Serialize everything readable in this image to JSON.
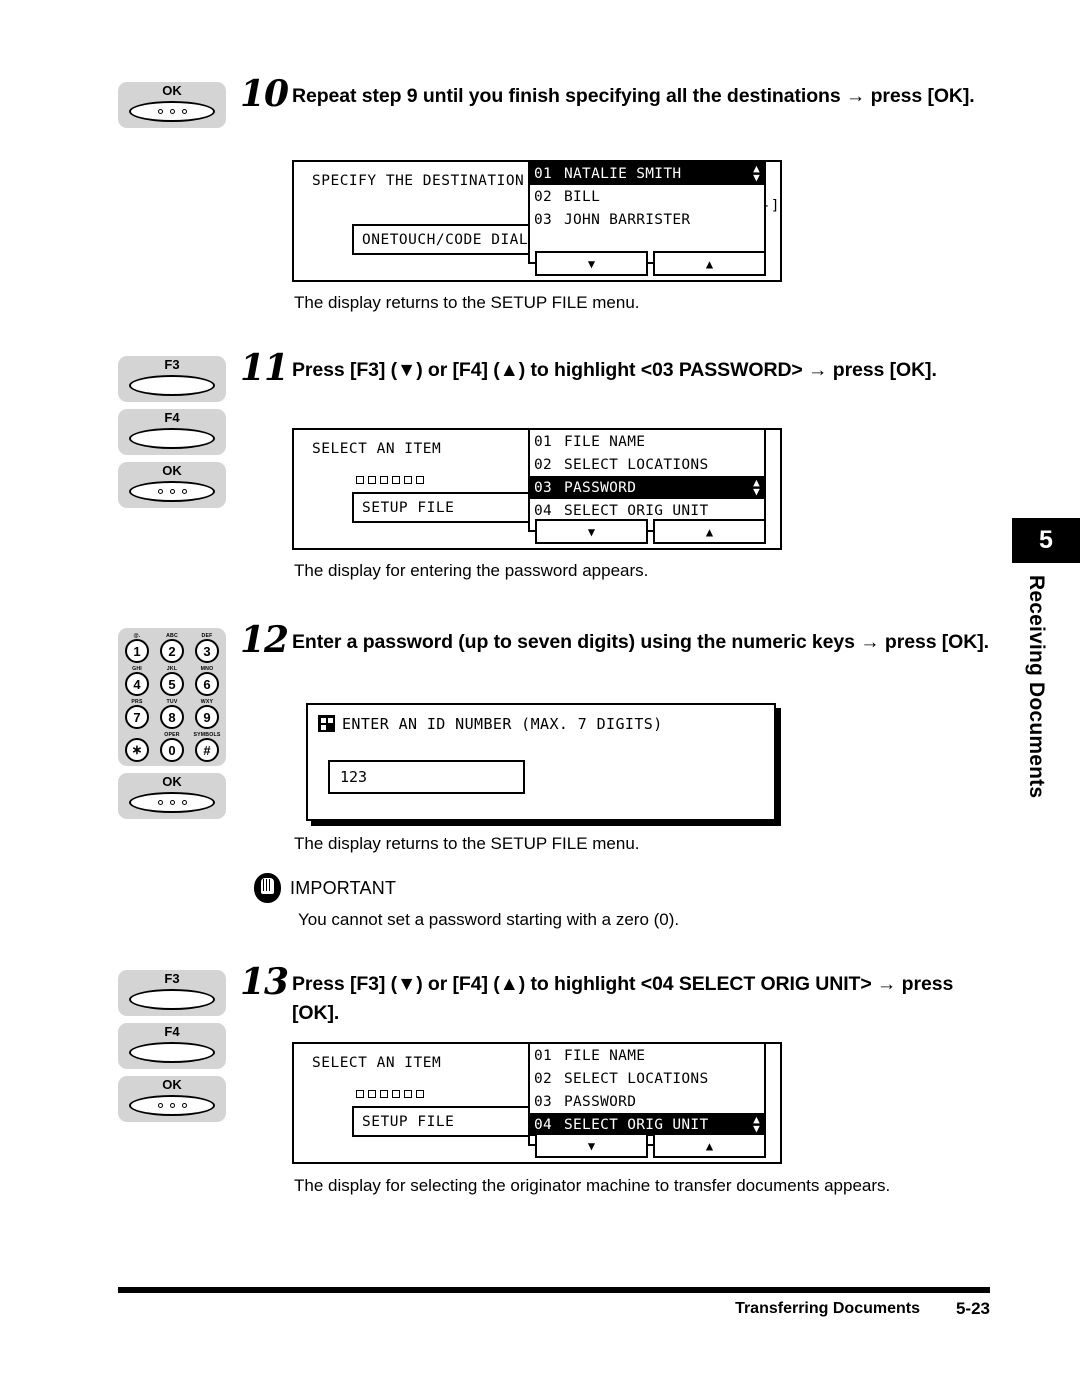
{
  "chapter_tab": {
    "number": "5",
    "title": "Receiving Documents"
  },
  "steps": [
    {
      "number": "10",
      "instruction": "Repeat step 9 until you finish specifying all the destinations → press [OK].",
      "keys": [
        {
          "label": "OK",
          "type": "lens-dots"
        }
      ],
      "caption": "The display returns to the SETUP FILE menu.",
      "lcd": {
        "type": "list",
        "title": "SPECIFY THE DESTINATION",
        "number_field": "No. [----]",
        "left_box": "ONETOUCH/CODE DIAL",
        "show_squares": false,
        "rows": [
          {
            "index": "01",
            "label": "NATALIE SMITH",
            "selected": true
          },
          {
            "index": "02",
            "label": "BILL",
            "selected": false
          },
          {
            "index": "03",
            "label": "JOHN BARRISTER",
            "selected": false
          }
        ],
        "softkeys": [
          "▼",
          "▲"
        ]
      }
    },
    {
      "number": "11",
      "instruction": "Press [F3] (▼) or [F4] (▲) to highlight <03 PASSWORD> → press [OK].",
      "keys": [
        {
          "label": "F3",
          "type": "lens"
        },
        {
          "label": "F4",
          "type": "lens"
        },
        {
          "label": "OK",
          "type": "lens-dots"
        }
      ],
      "caption": "The display for entering the password appears.",
      "lcd": {
        "type": "list",
        "title": "SELECT AN ITEM",
        "number_field": "",
        "left_box": "SETUP FILE",
        "show_squares": true,
        "rows": [
          {
            "index": "01",
            "label": "FILE NAME",
            "selected": false
          },
          {
            "index": "02",
            "label": "SELECT LOCATIONS",
            "selected": false
          },
          {
            "index": "03",
            "label": "PASSWORD",
            "selected": true
          },
          {
            "index": "04",
            "label": "SELECT ORIG UNIT",
            "selected": false
          }
        ],
        "softkeys": [
          "▼",
          "▲"
        ]
      }
    },
    {
      "number": "12",
      "instruction": "Enter a password (up to seven digits) using the numeric keys → press [OK].",
      "keys": [
        {
          "label": "numeric-keypad",
          "type": "numpad"
        },
        {
          "label": "OK",
          "type": "lens-dots"
        }
      ],
      "caption": "The display returns to the SETUP FILE menu.",
      "lcd": {
        "type": "entry",
        "title": "ENTER AN ID NUMBER (MAX. 7 DIGITS)",
        "value": "123"
      }
    },
    {
      "number": "13",
      "instruction": "Press [F3] (▼) or [F4] (▲) to highlight <04 SELECT ORIG UNIT> → press [OK].",
      "keys": [
        {
          "label": "F3",
          "type": "lens"
        },
        {
          "label": "F4",
          "type": "lens"
        },
        {
          "label": "OK",
          "type": "lens-dots"
        }
      ],
      "caption": "The display for selecting the originator machine to transfer documents appears.",
      "lcd": {
        "type": "list",
        "title": "SELECT AN ITEM",
        "number_field": "",
        "left_box": "SETUP FILE",
        "show_squares": true,
        "rows": [
          {
            "index": "01",
            "label": "FILE NAME",
            "selected": false
          },
          {
            "index": "02",
            "label": "SELECT LOCATIONS",
            "selected": false
          },
          {
            "index": "03",
            "label": "PASSWORD",
            "selected": false
          },
          {
            "index": "04",
            "label": "SELECT ORIG UNIT",
            "selected": true
          }
        ],
        "softkeys": [
          "▼",
          "▲"
        ]
      }
    }
  ],
  "numpad_keys": [
    {
      "digit": "1",
      "sub": "@."
    },
    {
      "digit": "2",
      "sub": "ABC"
    },
    {
      "digit": "3",
      "sub": "DEF"
    },
    {
      "digit": "4",
      "sub": "GHI"
    },
    {
      "digit": "5",
      "sub": "JKL"
    },
    {
      "digit": "6",
      "sub": "MNO"
    },
    {
      "digit": "7",
      "sub": "PRS"
    },
    {
      "digit": "8",
      "sub": "TUV"
    },
    {
      "digit": "9",
      "sub": "WXY"
    },
    {
      "digit": "∗",
      "sub": ""
    },
    {
      "digit": "0",
      "sub": "OPER"
    },
    {
      "digit": "#",
      "sub": "SYMBOLS"
    }
  ],
  "important": {
    "title": "IMPORTANT",
    "body": "You cannot set a password starting with a zero (0)."
  },
  "footer": {
    "section_title": "Transferring Documents",
    "page_number": "5-23"
  }
}
